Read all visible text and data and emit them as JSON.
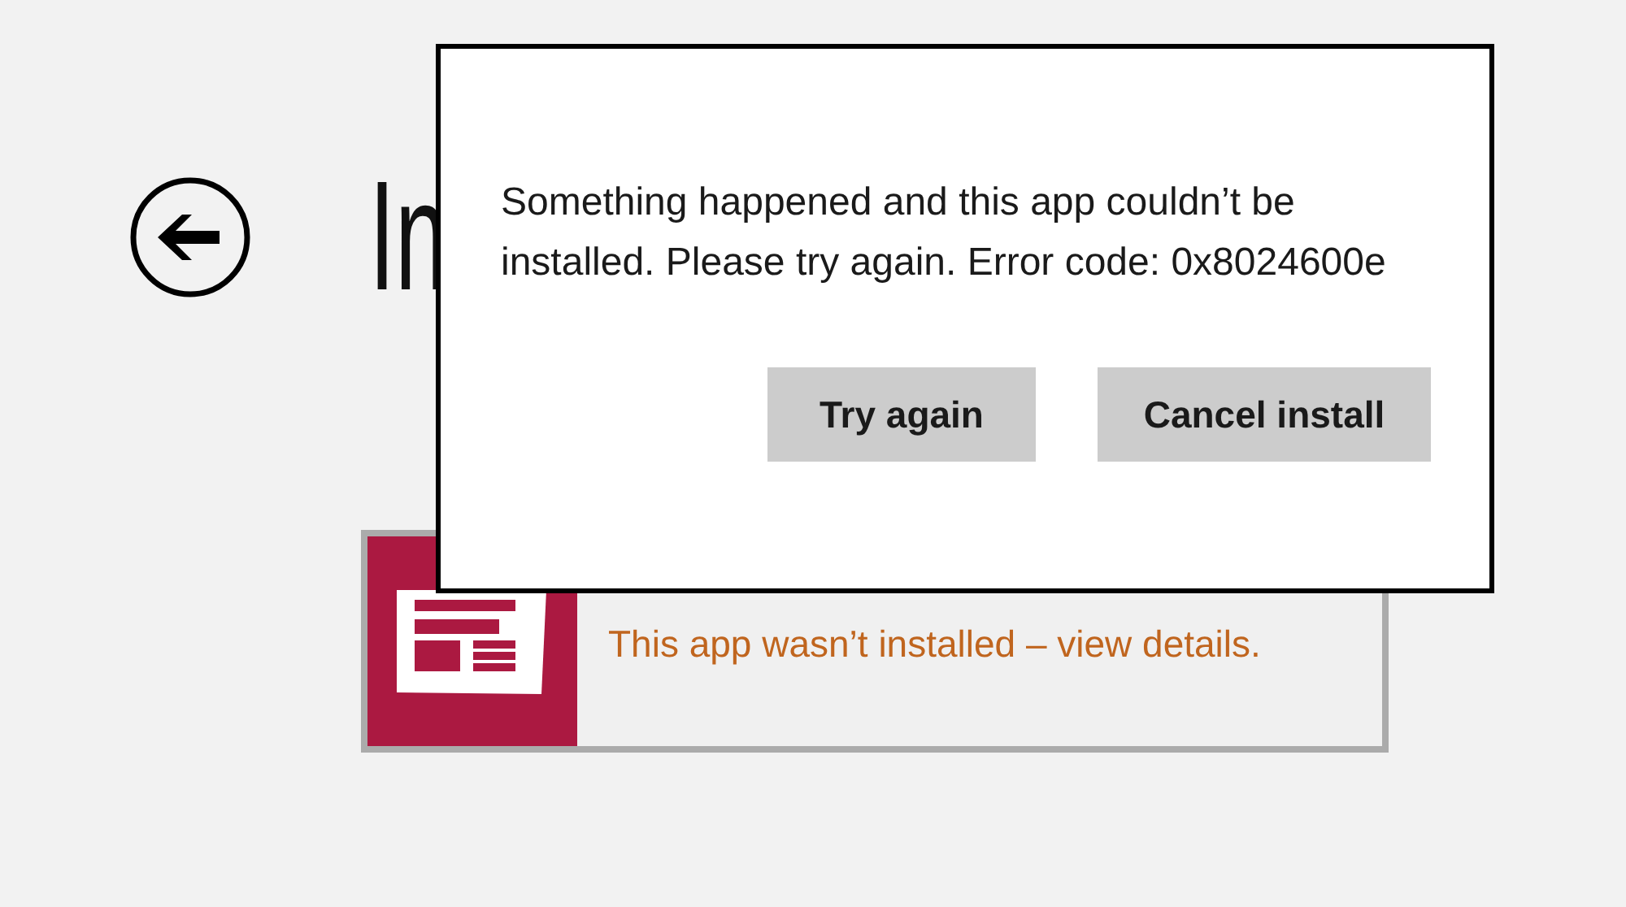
{
  "page": {
    "title": "In"
  },
  "app_tile": {
    "message": "This app wasn’t installed – view details."
  },
  "dialog": {
    "message": "Something happened and this app couldn’t be installed. Please try again. Error code: 0x8024600e",
    "buttons": [
      "Try again",
      "Cancel install"
    ]
  }
}
